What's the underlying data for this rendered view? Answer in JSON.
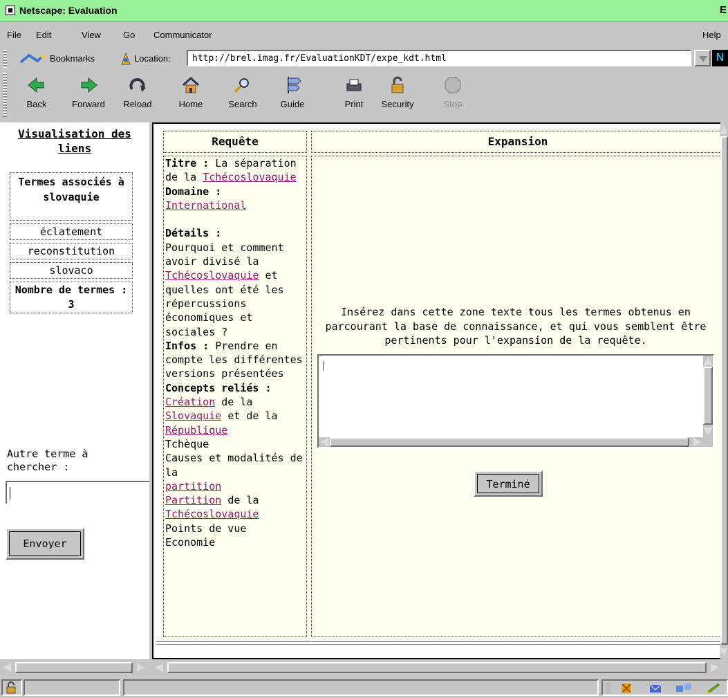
{
  "window": {
    "title": "Netscape: Evaluation",
    "title_right": "E"
  },
  "menu": {
    "file": "File",
    "edit": "Edit",
    "view": "View",
    "go": "Go",
    "communicator": "Communicator",
    "help": "Help"
  },
  "location": {
    "bookmarks": "Bookmarks",
    "label": "Location:",
    "url": "http://brel.imag.fr/EvaluationKDT/expe_kdt.html"
  },
  "toolbar": {
    "back": "Back",
    "forward": "Forward",
    "reload": "Reload",
    "home": "Home",
    "search": "Search",
    "guide": "Guide",
    "print": "Print",
    "security": "Security",
    "stop": "Stop"
  },
  "left": {
    "title": "Visualisation des liens",
    "terms_header": "Termes associés à slovaquie",
    "terms": [
      "éclatement",
      "reconstitution",
      "slovaco"
    ],
    "count_label": "Nombre de termes : 3",
    "other_label": "Autre terme à chercher :",
    "input_value": "",
    "send": "Envoyer"
  },
  "table": {
    "col_request": "Requête",
    "col_expansion": "Expansion",
    "request": {
      "titre_label": "Titre :",
      "titre_text": "La séparation de la",
      "titre_link": "Tchécoslovaquie",
      "domaine_label": "Domaine :",
      "domaine_link": "International",
      "details_label": "Détails :",
      "details_text_1": "Pourquoi et comment avoir divisé la",
      "details_link": "Tchécoslovaquie",
      "details_text_2": "et quelles ont été les répercussions économiques et sociales ?",
      "infos_label": "Infos :",
      "infos_text": "Prendre en compte les différentes versions présentées",
      "concepts_label": "Concepts reliés :",
      "c_creation": "Création",
      "c_de_la_1": "de la",
      "c_slovaquie": "Slovaquie",
      "c_et_de": "et de la",
      "c_republique": "République",
      "c_tcheque": "Tchèque",
      "c_causes": "Causes et modalités de la",
      "c_partition": "partition",
      "c_partition2": "Partition",
      "c_de_la_2": "de la",
      "c_tchecoslovaquie": "Tchécoslovaquie",
      "c_points": "Points de vue",
      "c_economie": "Economie"
    },
    "instruction": "Insérez dans cette zone texte tous les termes obtenus en parcourant la base de connaissance, et qui vous semblent être pertinents pour l'expansion de la requête.",
    "textarea_value": "",
    "done": "Terminé"
  },
  "colors": {
    "titlebar": "#98f098",
    "chrome": "#c6c6c6",
    "link": "#9a1a6a",
    "cell_bg": "#fffff0"
  },
  "icons": {
    "back": "back-arrow-icon",
    "forward": "forward-arrow-icon",
    "reload": "reload-icon",
    "home": "home-icon",
    "search": "search-icon",
    "guide": "guide-icon",
    "print": "printer-icon",
    "security": "lock-icon",
    "stop": "stop-icon"
  }
}
